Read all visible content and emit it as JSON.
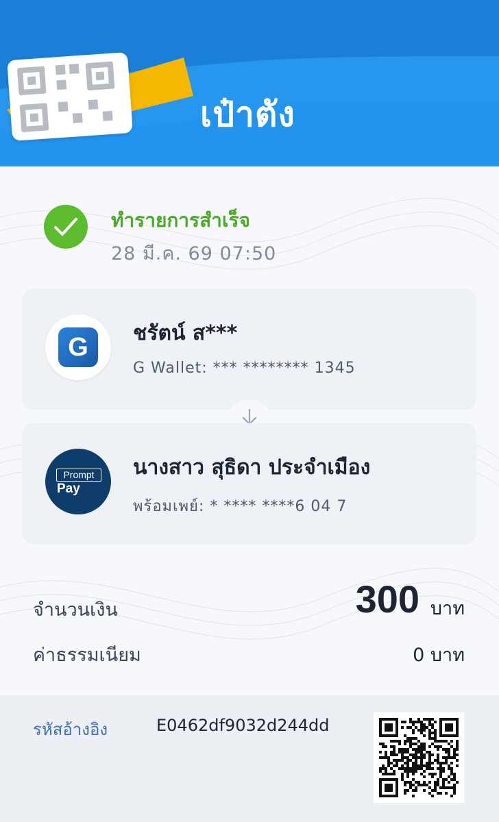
{
  "header": {
    "title": "เป๋าตัง"
  },
  "status": {
    "title": "ทำรายการสำเร็จ",
    "datetime": "28 มี.ค. 69 07:50",
    "color": "#5dbb2e"
  },
  "sender": {
    "icon": "g-wallet-icon",
    "icon_letter": "G",
    "name": "ชรัตน์ ส***",
    "account": "G Wallet: *** ******** 1345"
  },
  "receiver": {
    "icon": "promptpay-icon",
    "icon_top": "Prompt",
    "icon_bottom": "Pay",
    "name": "นางสาว สุธิดา ประจำเมือง",
    "account": "พร้อมเพย์: * **** ****6 04 7"
  },
  "amount": {
    "label": "จำนวนเงิน",
    "value": "300",
    "unit": "บาท"
  },
  "fee": {
    "label": "ค่าธรรมเนียม",
    "value": "0 บาท"
  },
  "reference": {
    "label": "รหัสอ้างอิง",
    "value": "E0462df9032d244dd"
  },
  "colors": {
    "header_blue": "#1a7fd6",
    "header_light_blue": "#2696ef",
    "accent_yellow": "#f6b700",
    "success_green": "#5dbb2e",
    "promptpay_navy": "#0f3d6b"
  }
}
